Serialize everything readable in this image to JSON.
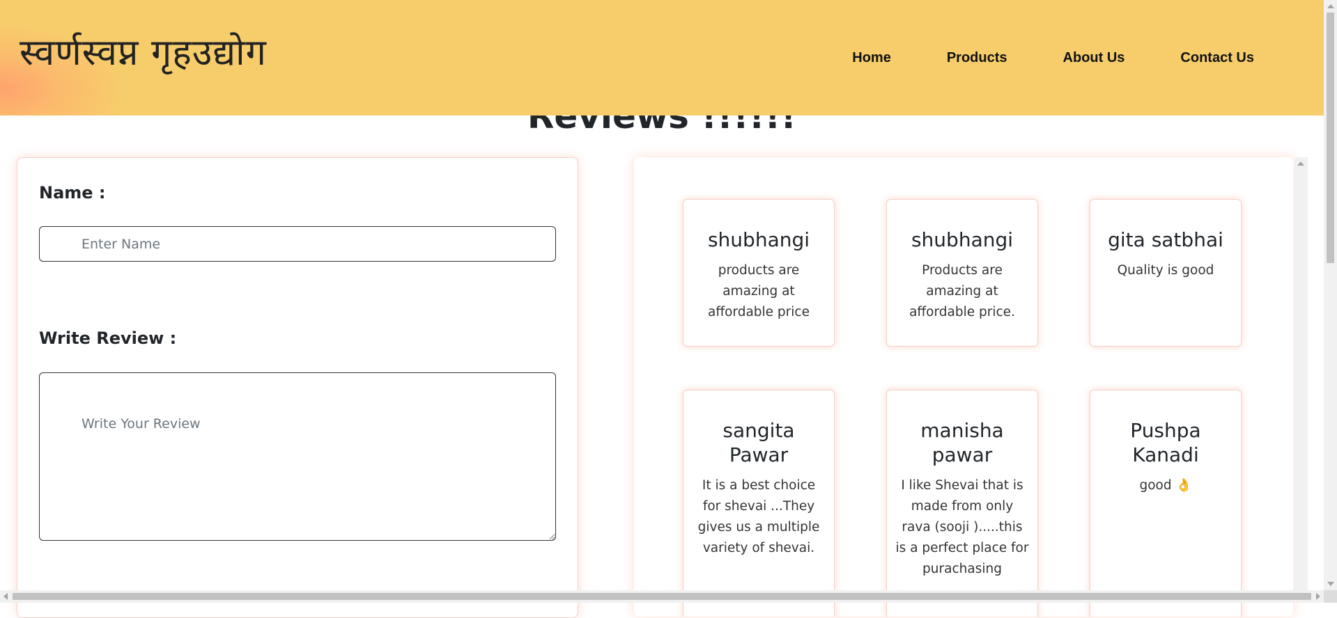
{
  "header": {
    "brand": "स्वर्णस्वप्न  गृहउद्योग",
    "nav": [
      "Home",
      "Products",
      "About Us",
      "Contact Us"
    ]
  },
  "page": {
    "heading": "Reviews !!!!!!"
  },
  "form": {
    "name_label": "Name :",
    "name_placeholder": "Enter Name",
    "review_label": "Write Review :",
    "review_placeholder": "Write Your Review"
  },
  "reviews": [
    {
      "name": "shubhangi",
      "text": "products are amazing at affordable price"
    },
    {
      "name": "shubhangi",
      "text": "Products are amazing at affordable price."
    },
    {
      "name": "gita satbhai",
      "text": "Quality is good"
    },
    {
      "name": "sangita Pawar",
      "text": "It is a best choice for shevai ...They gives us a multiple variety of shevai."
    },
    {
      "name": "manisha pawar",
      "text": "I like Shevai that is made from only rava (sooji ).....this is a perfect place for purachasing"
    },
    {
      "name": "Pushpa Kanadi",
      "text": "good 👌"
    }
  ],
  "colors": {
    "navbar": "#f7cd6b",
    "accent_glow": "#ffa06e",
    "text": "#212529"
  }
}
